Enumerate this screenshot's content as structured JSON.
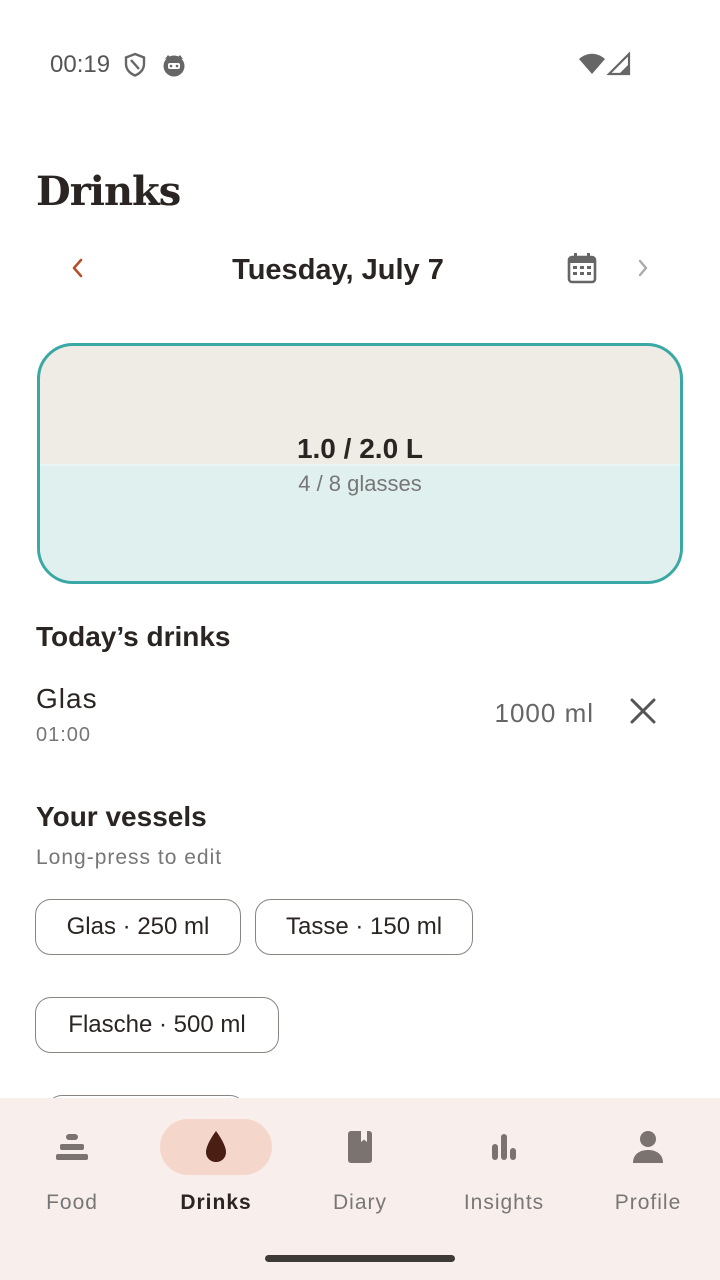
{
  "status_bar": {
    "time": "00:19",
    "icons": [
      "shield-icon",
      "cat-face-icon",
      "wifi-icon",
      "signal-icon"
    ]
  },
  "page": {
    "title": "Drinks"
  },
  "date_nav": {
    "label": "Tuesday, July 7",
    "prev_icon": "chevron-left-icon",
    "next_icon": "chevron-right-icon",
    "calendar_icon": "calendar-icon"
  },
  "progress": {
    "amount": "1.0 / 2.0 L",
    "glasses": "4 / 8 glasses",
    "fill_fraction": 0.5
  },
  "todays_drinks": {
    "title": "Today’s drinks",
    "items": [
      {
        "name": "Glas",
        "time": "01:00",
        "amount": "1000 ml"
      }
    ]
  },
  "vessels": {
    "title": "Your vessels",
    "hint": "Long-press to edit",
    "items": [
      {
        "label": "Glas · 250 ml"
      },
      {
        "label": "Tasse · 150 ml"
      },
      {
        "label": "Flasche · 500 ml"
      }
    ]
  },
  "bottom_nav": {
    "items": [
      {
        "label": "Food",
        "icon": "food-icon",
        "active": false
      },
      {
        "label": "Drinks",
        "icon": "drop-icon",
        "active": true
      },
      {
        "label": "Diary",
        "icon": "diary-icon",
        "active": false
      },
      {
        "label": "Insights",
        "icon": "bar-chart-icon",
        "active": false
      },
      {
        "label": "Profile",
        "icon": "person-icon",
        "active": false
      }
    ]
  },
  "colors": {
    "accent": "#3aa8a4",
    "brand": "#b5512e",
    "nav_active_bg": "#f5d6cb",
    "nav_bg": "#f8eeeb",
    "water_fill": "#dff0ee",
    "card_bg": "#efebe5"
  }
}
